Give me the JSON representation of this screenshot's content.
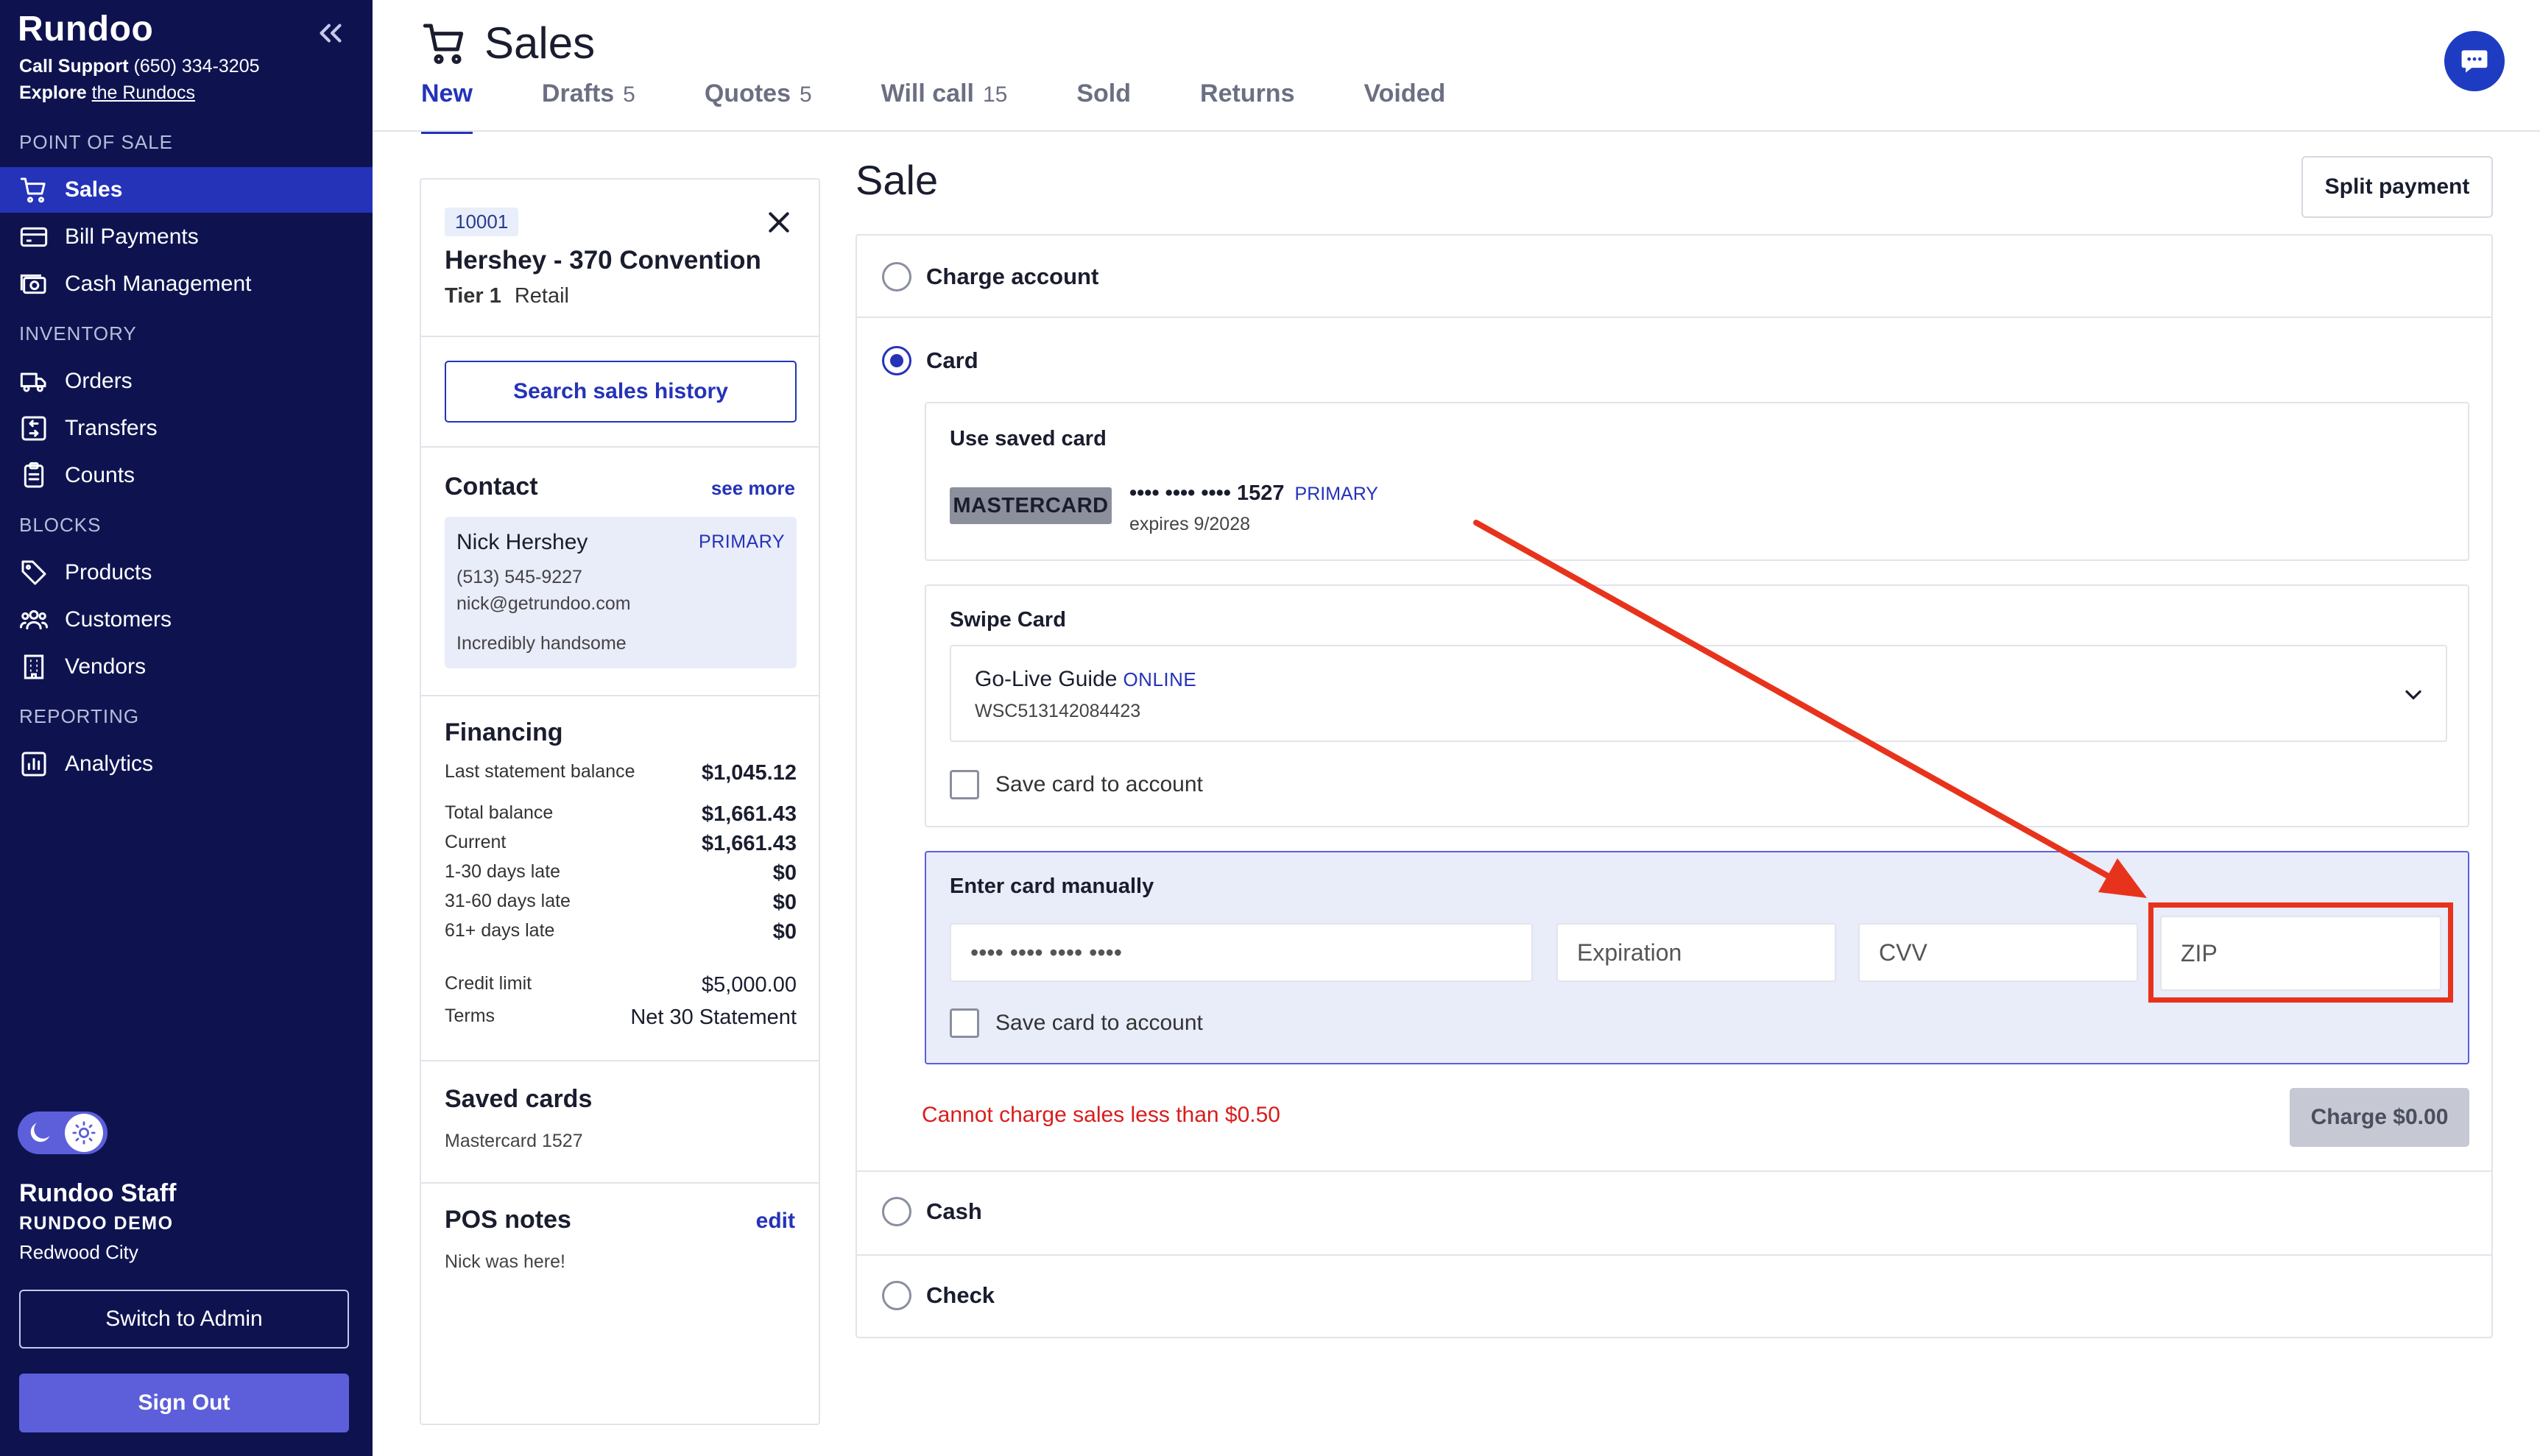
{
  "app": {
    "brand": "Rundoo",
    "support_label": "Call Support",
    "support_phone": "(650) 334-3205",
    "explore_label": "Explore",
    "explore_link": "the Rundocs"
  },
  "sidebar": {
    "sections": [
      {
        "label": "POINT OF SALE",
        "items": [
          {
            "label": "Sales",
            "icon": "cart-icon",
            "active": true
          },
          {
            "label": "Bill Payments",
            "icon": "credit-card-icon"
          },
          {
            "label": "Cash Management",
            "icon": "cash-register-icon"
          }
        ]
      },
      {
        "label": "INVENTORY",
        "items": [
          {
            "label": "Orders",
            "icon": "truck-icon"
          },
          {
            "label": "Transfers",
            "icon": "transfer-icon"
          },
          {
            "label": "Counts",
            "icon": "clipboard-icon"
          }
        ]
      },
      {
        "label": "BLOCKS",
        "items": [
          {
            "label": "Products",
            "icon": "tag-icon"
          },
          {
            "label": "Customers",
            "icon": "users-icon"
          },
          {
            "label": "Vendors",
            "icon": "building-icon"
          }
        ]
      },
      {
        "label": "REPORTING",
        "items": [
          {
            "label": "Analytics",
            "icon": "chart-icon"
          }
        ]
      }
    ],
    "user": {
      "name": "Rundoo Staff",
      "org": "RUNDOO DEMO",
      "city": "Redwood City"
    },
    "switch_admin": "Switch to Admin",
    "sign_out": "Sign Out"
  },
  "header": {
    "title": "Sales",
    "tabs": [
      {
        "label": "New",
        "count": ""
      },
      {
        "label": "Drafts",
        "count": "5"
      },
      {
        "label": "Quotes",
        "count": "5"
      },
      {
        "label": "Will call",
        "count": "15"
      },
      {
        "label": "Sold",
        "count": ""
      },
      {
        "label": "Returns",
        "count": ""
      },
      {
        "label": "Voided",
        "count": ""
      }
    ]
  },
  "customer": {
    "id": "10001",
    "name": "Hershey - 370 Convention",
    "tier": "Tier 1",
    "type": "Retail",
    "search_history": "Search sales history",
    "contact_heading": "Contact",
    "see_more": "see more",
    "contact": {
      "name": "Nick Hershey",
      "badge": "PRIMARY",
      "phone": "(513) 545-9227",
      "email": "nick@getrundoo.com",
      "note": "Incredibly handsome"
    },
    "financing_heading": "Financing",
    "financing": [
      {
        "label": "Last statement balance",
        "value": "$1,045.12"
      },
      {
        "label": "Total balance",
        "value": "$1,661.43"
      },
      {
        "label": "Current",
        "value": "$1,661.43"
      },
      {
        "label": "1-30 days late",
        "value": "$0"
      },
      {
        "label": "31-60 days late",
        "value": "$0"
      },
      {
        "label": "61+ days late",
        "value": "$0"
      }
    ],
    "credit_limit_label": "Credit limit",
    "credit_limit_value": "$5,000.00",
    "terms_label": "Terms",
    "terms_value": "Net 30 Statement",
    "saved_cards_heading": "Saved cards",
    "saved_cards_value": "Mastercard 1527",
    "pos_notes_heading": "POS notes",
    "pos_notes_edit": "edit",
    "pos_notes_value": "Nick was here!"
  },
  "sale": {
    "title": "Sale",
    "split_payment": "Split payment",
    "methods": {
      "charge_account": "Charge account",
      "card": "Card",
      "cash": "Cash",
      "check": "Check"
    },
    "saved_card": {
      "heading": "Use saved card",
      "brand": "MASTERCARD",
      "number": "•••• •••• •••• 1527",
      "badge": "PRIMARY",
      "expires": "expires 9/2028"
    },
    "swipe": {
      "heading": "Swipe Card",
      "device": "Go-Live Guide",
      "status": "ONLINE",
      "serial": "WSC513142084423",
      "save_label": "Save card to account"
    },
    "manual": {
      "heading": "Enter card manually",
      "card_placeholder": "•••• •••• •••• ••••",
      "exp_placeholder": "Expiration",
      "cvv_placeholder": "CVV",
      "zip_placeholder": "ZIP",
      "save_label": "Save card to account"
    },
    "error": "Cannot charge sales less than $0.50",
    "charge_button": "Charge $0.00"
  },
  "colors": {
    "sidebar_bg": "#0e1350",
    "accent": "#2433b8",
    "annotation_red": "#e8331c"
  }
}
